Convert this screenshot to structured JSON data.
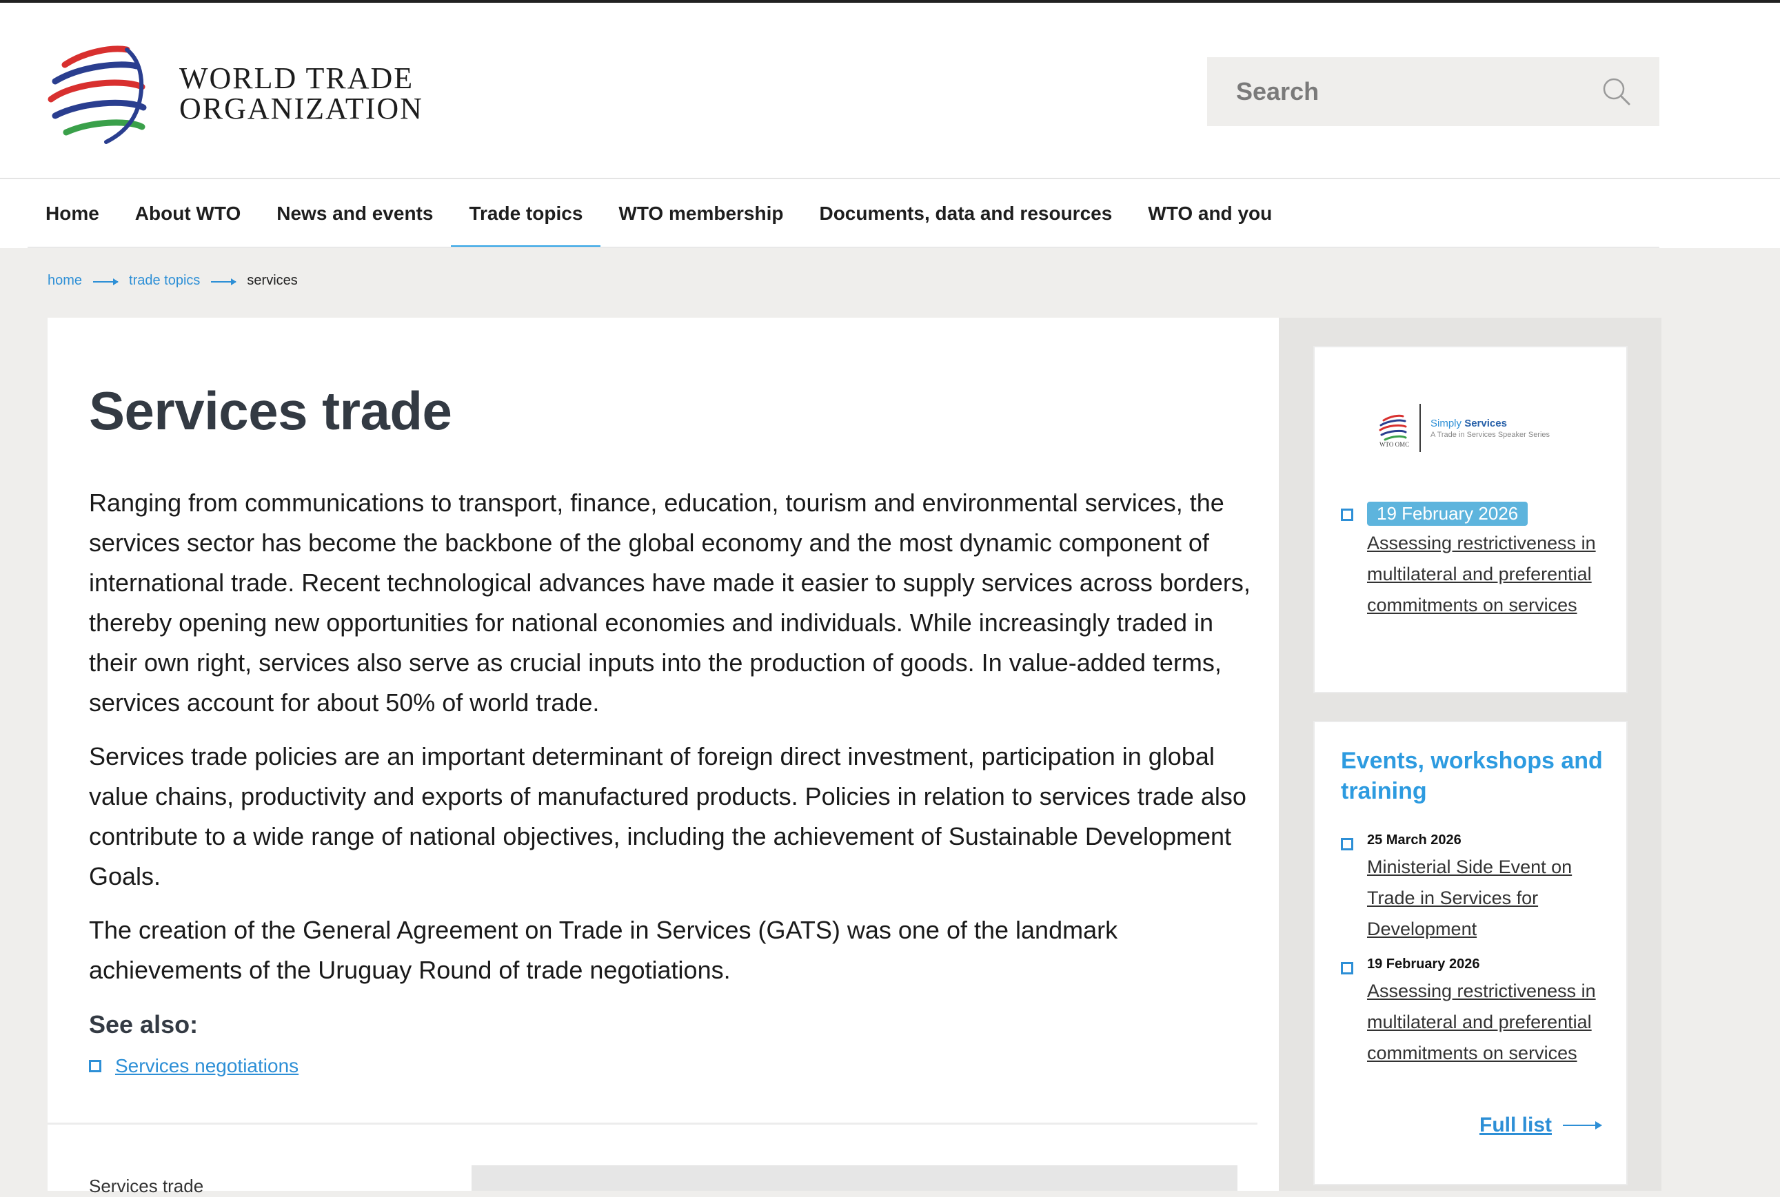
{
  "header": {
    "logo_line1": "WORLD TRADE",
    "logo_line2": "ORGANIZATION",
    "search_placeholder": "Search"
  },
  "nav": {
    "items": [
      {
        "label": "Home"
      },
      {
        "label": "About WTO"
      },
      {
        "label": "News and events"
      },
      {
        "label": "Trade topics",
        "active": true
      },
      {
        "label": "WTO membership"
      },
      {
        "label": "Documents, data and resources"
      },
      {
        "label": "WTO and you"
      }
    ]
  },
  "breadcrumb": {
    "home": "home",
    "trade_topics": "trade topics",
    "current": "services"
  },
  "main": {
    "title": "Services trade",
    "paragraphs": [
      "Ranging from communications to transport, finance, education, tourism and environmental services, the services sector has become the backbone of the global economy and the most dynamic component of international trade. Recent technological advances have made it easier to supply services across borders, thereby opening new opportunities for national economies and individuals. While increasingly traded in their own right, services also serve as crucial inputs into the production of goods. In value-added terms, services account for about 50% of world trade.",
      "Services trade policies are an important determinant of foreign direct investment, participation in global value chains, productivity and exports of manufactured products.  Policies in relation to services trade also contribute to a wide range of national objectives, including the achievement of Sustainable Development Goals.",
      "The creation of the General Agreement on Trade in Services (GATS) was one of the landmark achievements of the Uruguay Round of trade negotiations."
    ],
    "see_also_heading": "See also:",
    "see_also_link": "Services negotiations",
    "stub_text": "Services trade"
  },
  "sidebar": {
    "simply_services": {
      "wto_small": "WTO OMC",
      "title_part1": "Simply ",
      "title_part2": "Services",
      "subtitle": "A Trade in Services Speaker Series",
      "date": "19 February 2026",
      "link": "Assessing restrictiveness in multilateral and preferential commitments on services"
    },
    "events": {
      "heading": "Events, workshops and training",
      "items": [
        {
          "date": "25 March 2026",
          "link": "Ministerial Side Event on Trade in Services for Development"
        },
        {
          "date": "19 February 2026",
          "link": "Assessing restrictiveness in multilateral and preferential commitments on services"
        }
      ],
      "full_list": "Full list"
    }
  },
  "colors": {
    "accent_blue": "#2d8fd6",
    "badge_blue": "#5db4dd",
    "title_gray": "#333a43",
    "logo_red": "#d8302f",
    "logo_blue": "#2a3e8f",
    "logo_green": "#3aa04a"
  }
}
